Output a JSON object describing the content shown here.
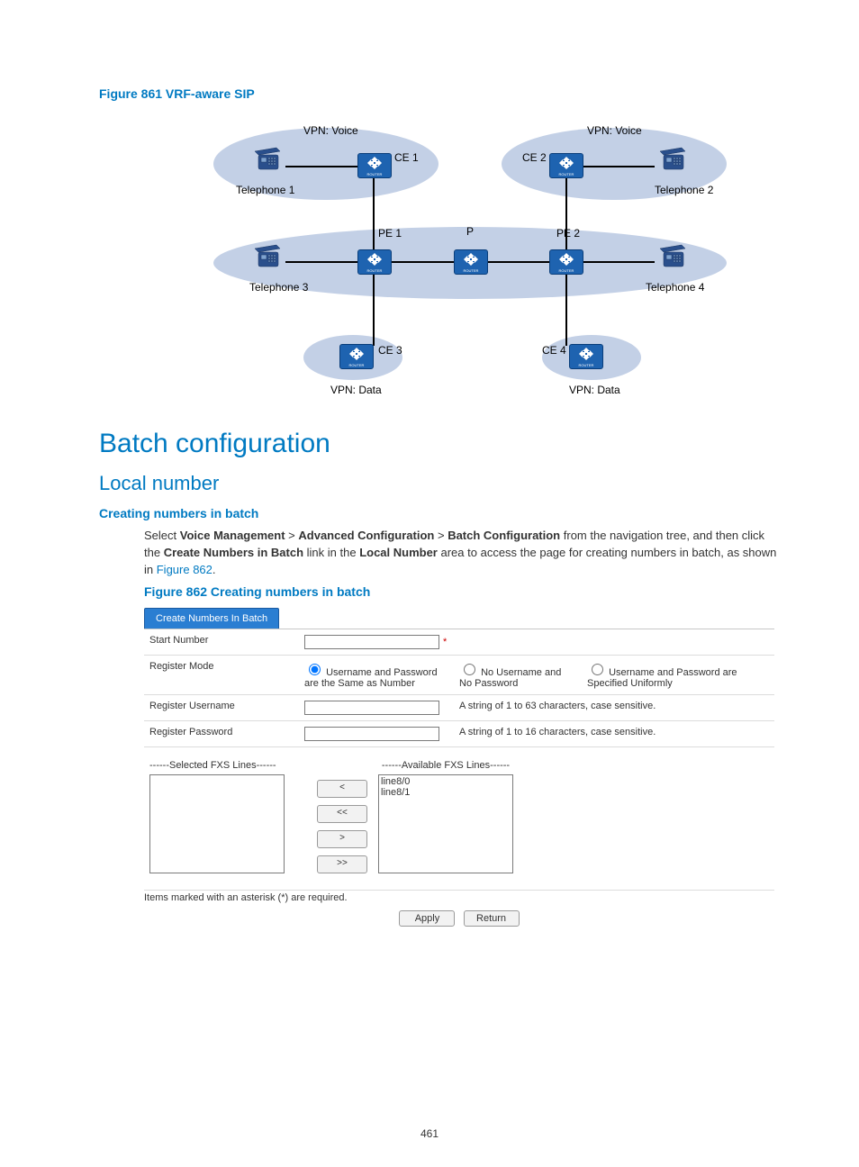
{
  "figure861": {
    "caption": "Figure 861 VRF-aware SIP",
    "labels": {
      "vpn_voice_left": "VPN: Voice",
      "vpn_voice_right": "VPN: Voice",
      "vpn_data_left": "VPN: Data",
      "vpn_data_right": "VPN: Data",
      "tel1": "Telephone 1",
      "tel2": "Telephone 2",
      "tel3": "Telephone 3",
      "tel4": "Telephone 4",
      "ce1": "CE 1",
      "ce2": "CE 2",
      "ce3": "CE 3",
      "ce4": "CE 4",
      "pe1": "PE 1",
      "pe2": "PE 2",
      "p": "P"
    }
  },
  "headings": {
    "h1": "Batch configuration",
    "h2": "Local number",
    "h3": "Creating numbers in batch"
  },
  "paragraph": {
    "part1": "Select ",
    "b1": "Voice Management",
    "sep": " > ",
    "b2": "Advanced Configuration",
    "b3": "Batch Configuration",
    "part2": " from the navigation tree, and then click the ",
    "b4": "Create Numbers in Batch",
    "part3": " link in the ",
    "b5": "Local Number",
    "part4": " area to access the page for creating numbers in batch, as shown in ",
    "link": "Figure 862",
    "end": "."
  },
  "figure862": {
    "caption": "Figure 862 Creating numbers in batch",
    "tab": "Create Numbers In Batch",
    "rows": {
      "start_number": "Start Number",
      "register_mode": "Register Mode",
      "register_username": "Register Username",
      "register_password": "Register Password"
    },
    "radios": {
      "opt1": "Username and Password are the Same as Number",
      "opt2": "No Username and No Password",
      "opt3": "Username and Password are Specified Uniformly"
    },
    "hints": {
      "uname": "A string of 1 to 63 characters, case sensitive.",
      "pwd": "A string of 1 to 16 characters, case sensitive."
    },
    "lists": {
      "selected_title": "------Selected FXS Lines------",
      "available_title": "------Available FXS Lines------",
      "available_items": [
        "line8/0",
        "line8/1"
      ]
    },
    "move_buttons": {
      "left": "<",
      "left_all": "<<",
      "right": ">",
      "right_all": ">>"
    },
    "footer_note": "Items marked with an asterisk (*) are required.",
    "apply": "Apply",
    "return": "Return"
  },
  "page_number": "461"
}
